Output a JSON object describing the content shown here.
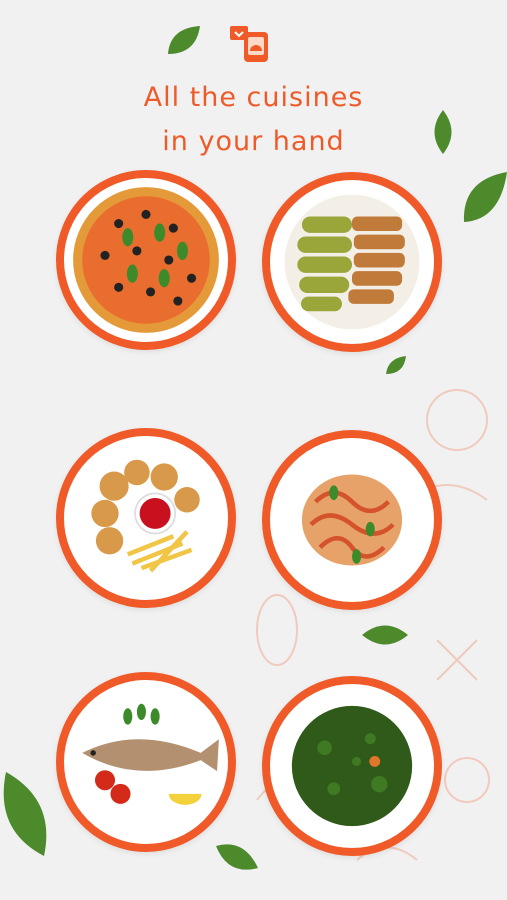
{
  "header": {
    "title_line1": "All the cuisines",
    "title_line2": "in your hand"
  },
  "dishes": [
    {
      "name": "pizza-dish-icon"
    },
    {
      "name": "stuffed-zucchini-dish-icon"
    },
    {
      "name": "fried-chicken-dish-icon"
    },
    {
      "name": "pasta-dish-icon"
    },
    {
      "name": "grilled-fish-dish-icon"
    },
    {
      "name": "molokhia-soup-dish-icon"
    }
  ],
  "colors": {
    "accent": "#f05a28",
    "background": "#f1f1f1",
    "leaf": "#4c8a2c"
  }
}
